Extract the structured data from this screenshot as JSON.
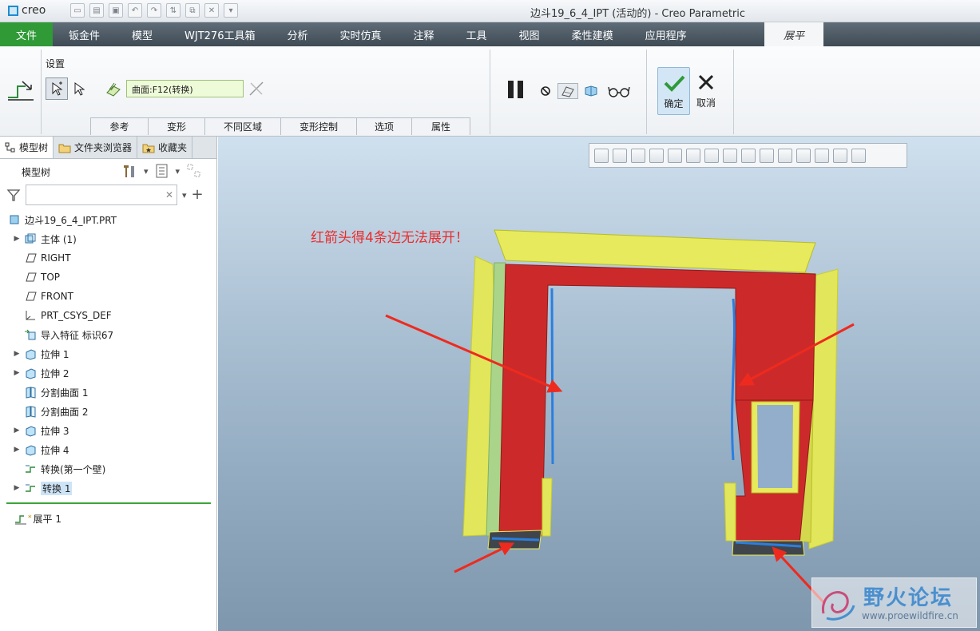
{
  "app": {
    "logo_text": "creo",
    "window_title": "边斗19_6_4_IPT (活动的) - Creo Parametric"
  },
  "menu": {
    "items": [
      "文件",
      "钣金件",
      "模型",
      "WJT276工具箱",
      "分析",
      "实时仿真",
      "注释",
      "工具",
      "视图",
      "柔性建模",
      "应用程序"
    ],
    "active_tab": "展平"
  },
  "ribbon": {
    "group_title": "设置",
    "surface_field_value": "曲面:F12(转换)",
    "subtabs": [
      "参考",
      "变形",
      "不同区域",
      "变形控制",
      "选项",
      "属性"
    ],
    "ok_label": "确定",
    "cancel_label": "取消",
    "ok_color": "#2e9a3a"
  },
  "left_panel": {
    "tabs": [
      "模型树",
      "文件夹浏览器",
      "收藏夹"
    ],
    "tree_title": "模型树",
    "search_placeholder": "",
    "nodes": [
      {
        "label": "边斗19_6_4_IPT.PRT",
        "icon": "part-icon",
        "expand": false,
        "indent": 0
      },
      {
        "label": "主体 (1)",
        "icon": "body-icon",
        "expand": true,
        "indent": 1
      },
      {
        "label": "RIGHT",
        "icon": "datum-plane-icon",
        "expand": false,
        "indent": 1
      },
      {
        "label": "TOP",
        "icon": "datum-plane-icon",
        "expand": false,
        "indent": 1
      },
      {
        "label": "FRONT",
        "icon": "datum-plane-icon",
        "expand": false,
        "indent": 1
      },
      {
        "label": "PRT_CSYS_DEF",
        "icon": "csys-icon",
        "expand": false,
        "indent": 1
      },
      {
        "label": "导入特征 标识67",
        "icon": "import-icon",
        "expand": false,
        "indent": 1
      },
      {
        "label": "拉伸 1",
        "icon": "extrude-icon",
        "expand": true,
        "indent": 1
      },
      {
        "label": "拉伸 2",
        "icon": "extrude-icon",
        "expand": true,
        "indent": 1
      },
      {
        "label": "分割曲面 1",
        "icon": "split-surface-icon",
        "expand": false,
        "indent": 1
      },
      {
        "label": "分割曲面 2",
        "icon": "split-surface-icon",
        "expand": false,
        "indent": 1
      },
      {
        "label": "拉伸 3",
        "icon": "extrude-icon",
        "expand": true,
        "indent": 1
      },
      {
        "label": "拉伸 4",
        "icon": "extrude-icon",
        "expand": true,
        "indent": 1
      },
      {
        "label": "转换(第一个壁)",
        "icon": "convert-icon",
        "expand": false,
        "indent": 1
      },
      {
        "label": "转换 1",
        "icon": "convert-icon",
        "expand": true,
        "indent": 1,
        "selected": true
      }
    ],
    "insert_node": {
      "label": "展平 1",
      "icon": "flatten-icon"
    }
  },
  "graphics": {
    "annotation": "红箭头得4条边无法展开！",
    "annotation_color": "#e82d2d",
    "watermark_title": "野火论坛",
    "watermark_url": "www.proewildfire.cn"
  }
}
